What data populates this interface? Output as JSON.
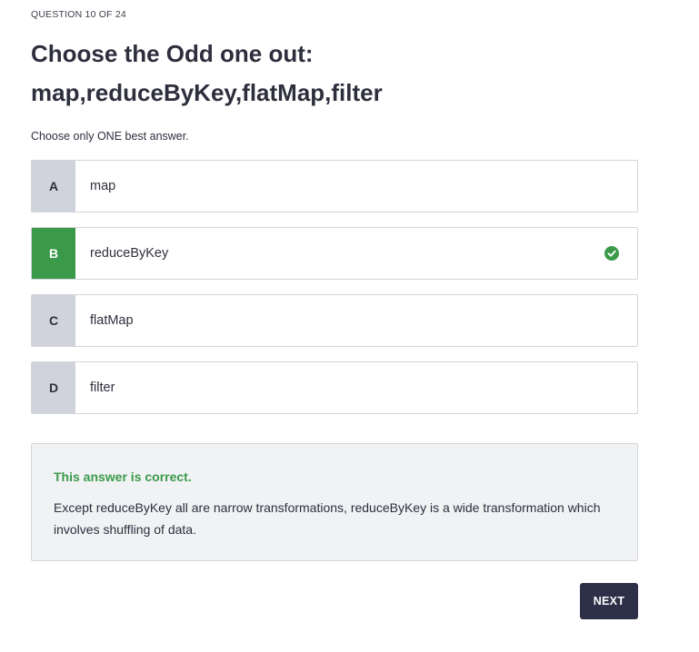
{
  "header": {
    "counter": "QUESTION 10 OF 24"
  },
  "question": {
    "title_line1": "Choose the Odd one out:",
    "title_line2": "map,reduceByKey,flatMap,filter",
    "instruction": "Choose only ONE best answer."
  },
  "options": [
    {
      "letter": "A",
      "text": "map",
      "state": "unselected"
    },
    {
      "letter": "B",
      "text": "reduceByKey",
      "state": "correct"
    },
    {
      "letter": "C",
      "text": "flatMap",
      "state": "unselected"
    },
    {
      "letter": "D",
      "text": "filter",
      "state": "unselected"
    }
  ],
  "feedback": {
    "title": "This answer is correct.",
    "body": "Except reduceByKey all are narrow transformations, reduceByKey is a wide transformation which involves shuffling of data."
  },
  "actions": {
    "next_label": "NEXT"
  },
  "icons": {
    "correct": "check-circle-icon"
  },
  "colors": {
    "correct": "#3a9a4a",
    "letter_bg": "#d1d3dc",
    "next_bg": "#2e2f48",
    "feedback_bg": "#f1f2f4"
  }
}
